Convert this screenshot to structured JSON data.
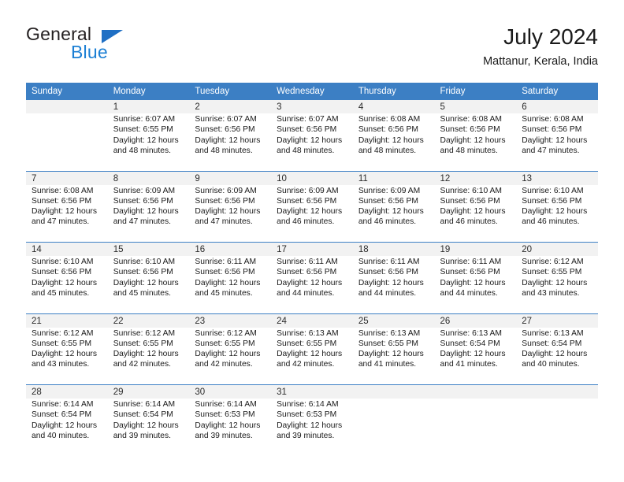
{
  "brand": {
    "name_part1": "General",
    "name_part2": "Blue",
    "accent_color": "#1b7fd4",
    "triangle_color": "#1f6fc4"
  },
  "header": {
    "title": "July 2024",
    "subtitle": "Mattanur, Kerala, India"
  },
  "calendar": {
    "header_bg": "#3c7fc4",
    "daynum_bg": "#f2f2f2",
    "weekdays": [
      "Sunday",
      "Monday",
      "Tuesday",
      "Wednesday",
      "Thursday",
      "Friday",
      "Saturday"
    ],
    "weeks": [
      [
        {
          "day": "",
          "sunrise": "",
          "sunset": "",
          "daylight_1": "",
          "daylight_2": ""
        },
        {
          "day": "1",
          "sunrise": "Sunrise: 6:07 AM",
          "sunset": "Sunset: 6:55 PM",
          "daylight_1": "Daylight: 12 hours",
          "daylight_2": "and 48 minutes."
        },
        {
          "day": "2",
          "sunrise": "Sunrise: 6:07 AM",
          "sunset": "Sunset: 6:56 PM",
          "daylight_1": "Daylight: 12 hours",
          "daylight_2": "and 48 minutes."
        },
        {
          "day": "3",
          "sunrise": "Sunrise: 6:07 AM",
          "sunset": "Sunset: 6:56 PM",
          "daylight_1": "Daylight: 12 hours",
          "daylight_2": "and 48 minutes."
        },
        {
          "day": "4",
          "sunrise": "Sunrise: 6:08 AM",
          "sunset": "Sunset: 6:56 PM",
          "daylight_1": "Daylight: 12 hours",
          "daylight_2": "and 48 minutes."
        },
        {
          "day": "5",
          "sunrise": "Sunrise: 6:08 AM",
          "sunset": "Sunset: 6:56 PM",
          "daylight_1": "Daylight: 12 hours",
          "daylight_2": "and 48 minutes."
        },
        {
          "day": "6",
          "sunrise": "Sunrise: 6:08 AM",
          "sunset": "Sunset: 6:56 PM",
          "daylight_1": "Daylight: 12 hours",
          "daylight_2": "and 47 minutes."
        }
      ],
      [
        {
          "day": "7",
          "sunrise": "Sunrise: 6:08 AM",
          "sunset": "Sunset: 6:56 PM",
          "daylight_1": "Daylight: 12 hours",
          "daylight_2": "and 47 minutes."
        },
        {
          "day": "8",
          "sunrise": "Sunrise: 6:09 AM",
          "sunset": "Sunset: 6:56 PM",
          "daylight_1": "Daylight: 12 hours",
          "daylight_2": "and 47 minutes."
        },
        {
          "day": "9",
          "sunrise": "Sunrise: 6:09 AM",
          "sunset": "Sunset: 6:56 PM",
          "daylight_1": "Daylight: 12 hours",
          "daylight_2": "and 47 minutes."
        },
        {
          "day": "10",
          "sunrise": "Sunrise: 6:09 AM",
          "sunset": "Sunset: 6:56 PM",
          "daylight_1": "Daylight: 12 hours",
          "daylight_2": "and 46 minutes."
        },
        {
          "day": "11",
          "sunrise": "Sunrise: 6:09 AM",
          "sunset": "Sunset: 6:56 PM",
          "daylight_1": "Daylight: 12 hours",
          "daylight_2": "and 46 minutes."
        },
        {
          "day": "12",
          "sunrise": "Sunrise: 6:10 AM",
          "sunset": "Sunset: 6:56 PM",
          "daylight_1": "Daylight: 12 hours",
          "daylight_2": "and 46 minutes."
        },
        {
          "day": "13",
          "sunrise": "Sunrise: 6:10 AM",
          "sunset": "Sunset: 6:56 PM",
          "daylight_1": "Daylight: 12 hours",
          "daylight_2": "and 46 minutes."
        }
      ],
      [
        {
          "day": "14",
          "sunrise": "Sunrise: 6:10 AM",
          "sunset": "Sunset: 6:56 PM",
          "daylight_1": "Daylight: 12 hours",
          "daylight_2": "and 45 minutes."
        },
        {
          "day": "15",
          "sunrise": "Sunrise: 6:10 AM",
          "sunset": "Sunset: 6:56 PM",
          "daylight_1": "Daylight: 12 hours",
          "daylight_2": "and 45 minutes."
        },
        {
          "day": "16",
          "sunrise": "Sunrise: 6:11 AM",
          "sunset": "Sunset: 6:56 PM",
          "daylight_1": "Daylight: 12 hours",
          "daylight_2": "and 45 minutes."
        },
        {
          "day": "17",
          "sunrise": "Sunrise: 6:11 AM",
          "sunset": "Sunset: 6:56 PM",
          "daylight_1": "Daylight: 12 hours",
          "daylight_2": "and 44 minutes."
        },
        {
          "day": "18",
          "sunrise": "Sunrise: 6:11 AM",
          "sunset": "Sunset: 6:56 PM",
          "daylight_1": "Daylight: 12 hours",
          "daylight_2": "and 44 minutes."
        },
        {
          "day": "19",
          "sunrise": "Sunrise: 6:11 AM",
          "sunset": "Sunset: 6:56 PM",
          "daylight_1": "Daylight: 12 hours",
          "daylight_2": "and 44 minutes."
        },
        {
          "day": "20",
          "sunrise": "Sunrise: 6:12 AM",
          "sunset": "Sunset: 6:55 PM",
          "daylight_1": "Daylight: 12 hours",
          "daylight_2": "and 43 minutes."
        }
      ],
      [
        {
          "day": "21",
          "sunrise": "Sunrise: 6:12 AM",
          "sunset": "Sunset: 6:55 PM",
          "daylight_1": "Daylight: 12 hours",
          "daylight_2": "and 43 minutes."
        },
        {
          "day": "22",
          "sunrise": "Sunrise: 6:12 AM",
          "sunset": "Sunset: 6:55 PM",
          "daylight_1": "Daylight: 12 hours",
          "daylight_2": "and 42 minutes."
        },
        {
          "day": "23",
          "sunrise": "Sunrise: 6:12 AM",
          "sunset": "Sunset: 6:55 PM",
          "daylight_1": "Daylight: 12 hours",
          "daylight_2": "and 42 minutes."
        },
        {
          "day": "24",
          "sunrise": "Sunrise: 6:13 AM",
          "sunset": "Sunset: 6:55 PM",
          "daylight_1": "Daylight: 12 hours",
          "daylight_2": "and 42 minutes."
        },
        {
          "day": "25",
          "sunrise": "Sunrise: 6:13 AM",
          "sunset": "Sunset: 6:55 PM",
          "daylight_1": "Daylight: 12 hours",
          "daylight_2": "and 41 minutes."
        },
        {
          "day": "26",
          "sunrise": "Sunrise: 6:13 AM",
          "sunset": "Sunset: 6:54 PM",
          "daylight_1": "Daylight: 12 hours",
          "daylight_2": "and 41 minutes."
        },
        {
          "day": "27",
          "sunrise": "Sunrise: 6:13 AM",
          "sunset": "Sunset: 6:54 PM",
          "daylight_1": "Daylight: 12 hours",
          "daylight_2": "and 40 minutes."
        }
      ],
      [
        {
          "day": "28",
          "sunrise": "Sunrise: 6:14 AM",
          "sunset": "Sunset: 6:54 PM",
          "daylight_1": "Daylight: 12 hours",
          "daylight_2": "and 40 minutes."
        },
        {
          "day": "29",
          "sunrise": "Sunrise: 6:14 AM",
          "sunset": "Sunset: 6:54 PM",
          "daylight_1": "Daylight: 12 hours",
          "daylight_2": "and 39 minutes."
        },
        {
          "day": "30",
          "sunrise": "Sunrise: 6:14 AM",
          "sunset": "Sunset: 6:53 PM",
          "daylight_1": "Daylight: 12 hours",
          "daylight_2": "and 39 minutes."
        },
        {
          "day": "31",
          "sunrise": "Sunrise: 6:14 AM",
          "sunset": "Sunset: 6:53 PM",
          "daylight_1": "Daylight: 12 hours",
          "daylight_2": "and 39 minutes."
        },
        {
          "day": "",
          "sunrise": "",
          "sunset": "",
          "daylight_1": "",
          "daylight_2": ""
        },
        {
          "day": "",
          "sunrise": "",
          "sunset": "",
          "daylight_1": "",
          "daylight_2": ""
        },
        {
          "day": "",
          "sunrise": "",
          "sunset": "",
          "daylight_1": "",
          "daylight_2": ""
        }
      ]
    ]
  }
}
